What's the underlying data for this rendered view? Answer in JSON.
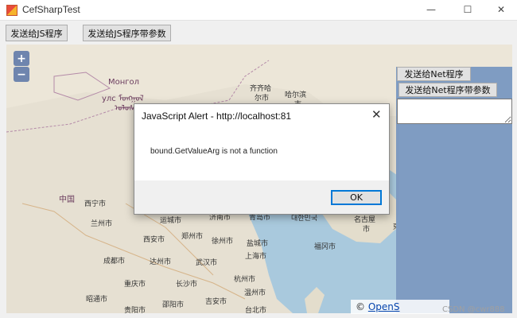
{
  "window": {
    "title": "CefSharpTest",
    "minimize_glyph": "—",
    "maximize_glyph": "☐",
    "close_glyph": "✕"
  },
  "toolbar": {
    "send_js_label": "发送给JS程序",
    "send_js_args_label": "发送给JS程序带参数"
  },
  "map": {
    "zoom_in": "+",
    "zoom_out": "−",
    "labels": {
      "mongolia": "Монгол",
      "mongolia_script": "улс ᠮᠣᠩᠭᠣᠯ",
      "mongolia_script2": "ᠤᠯᠤᠰ",
      "china": "中国",
      "qiqihar": "齐齐哈",
      "qiqihar2": "尔市",
      "harbin": "哈尔滨",
      "harbin2": "市",
      "xining": "西宁市",
      "lanzhou": "兰州市",
      "yuncheng": "运城市",
      "jinan": "济南市",
      "qingdao": "青岛市",
      "korea": "대한민국",
      "nagoya": "名古屋",
      "nagoya2": "市",
      "xian": "西安市",
      "zhengzhou": "郑州市",
      "xuzhou": "徐州市",
      "yancheng": "盐城市",
      "shanghai": "上海市",
      "fukuoka": "福冈市",
      "chengdu": "成都市",
      "dazhou": "达州市",
      "wuhan": "武汉市",
      "hangzhou": "杭州市",
      "chongqing": "重庆市",
      "changsha": "长沙市",
      "wenzhou": "温州市",
      "zhaotong": "昭通市",
      "shaoyang": "邵阳市",
      "jian": "吉安市",
      "guiyang": "贵阳市",
      "taipei": "台北市",
      "east": "東"
    },
    "attribution_prefix": "© ",
    "attribution_link": "OpenS"
  },
  "panel": {
    "send_net_label": "发送给Net程序",
    "send_net_args_label": "发送给Net程序带参数",
    "input_value": ""
  },
  "dialog": {
    "title": "JavaScript Alert - http://localhost:81",
    "message": "bound.GetValueArg is not a function",
    "ok_label": "OK",
    "close_glyph": "✕"
  },
  "watermark": "CSDN @cwr888",
  "colors": {
    "panel": "#7f9cc2",
    "accent": "#0078d7",
    "sea": "#a9c9dd"
  }
}
